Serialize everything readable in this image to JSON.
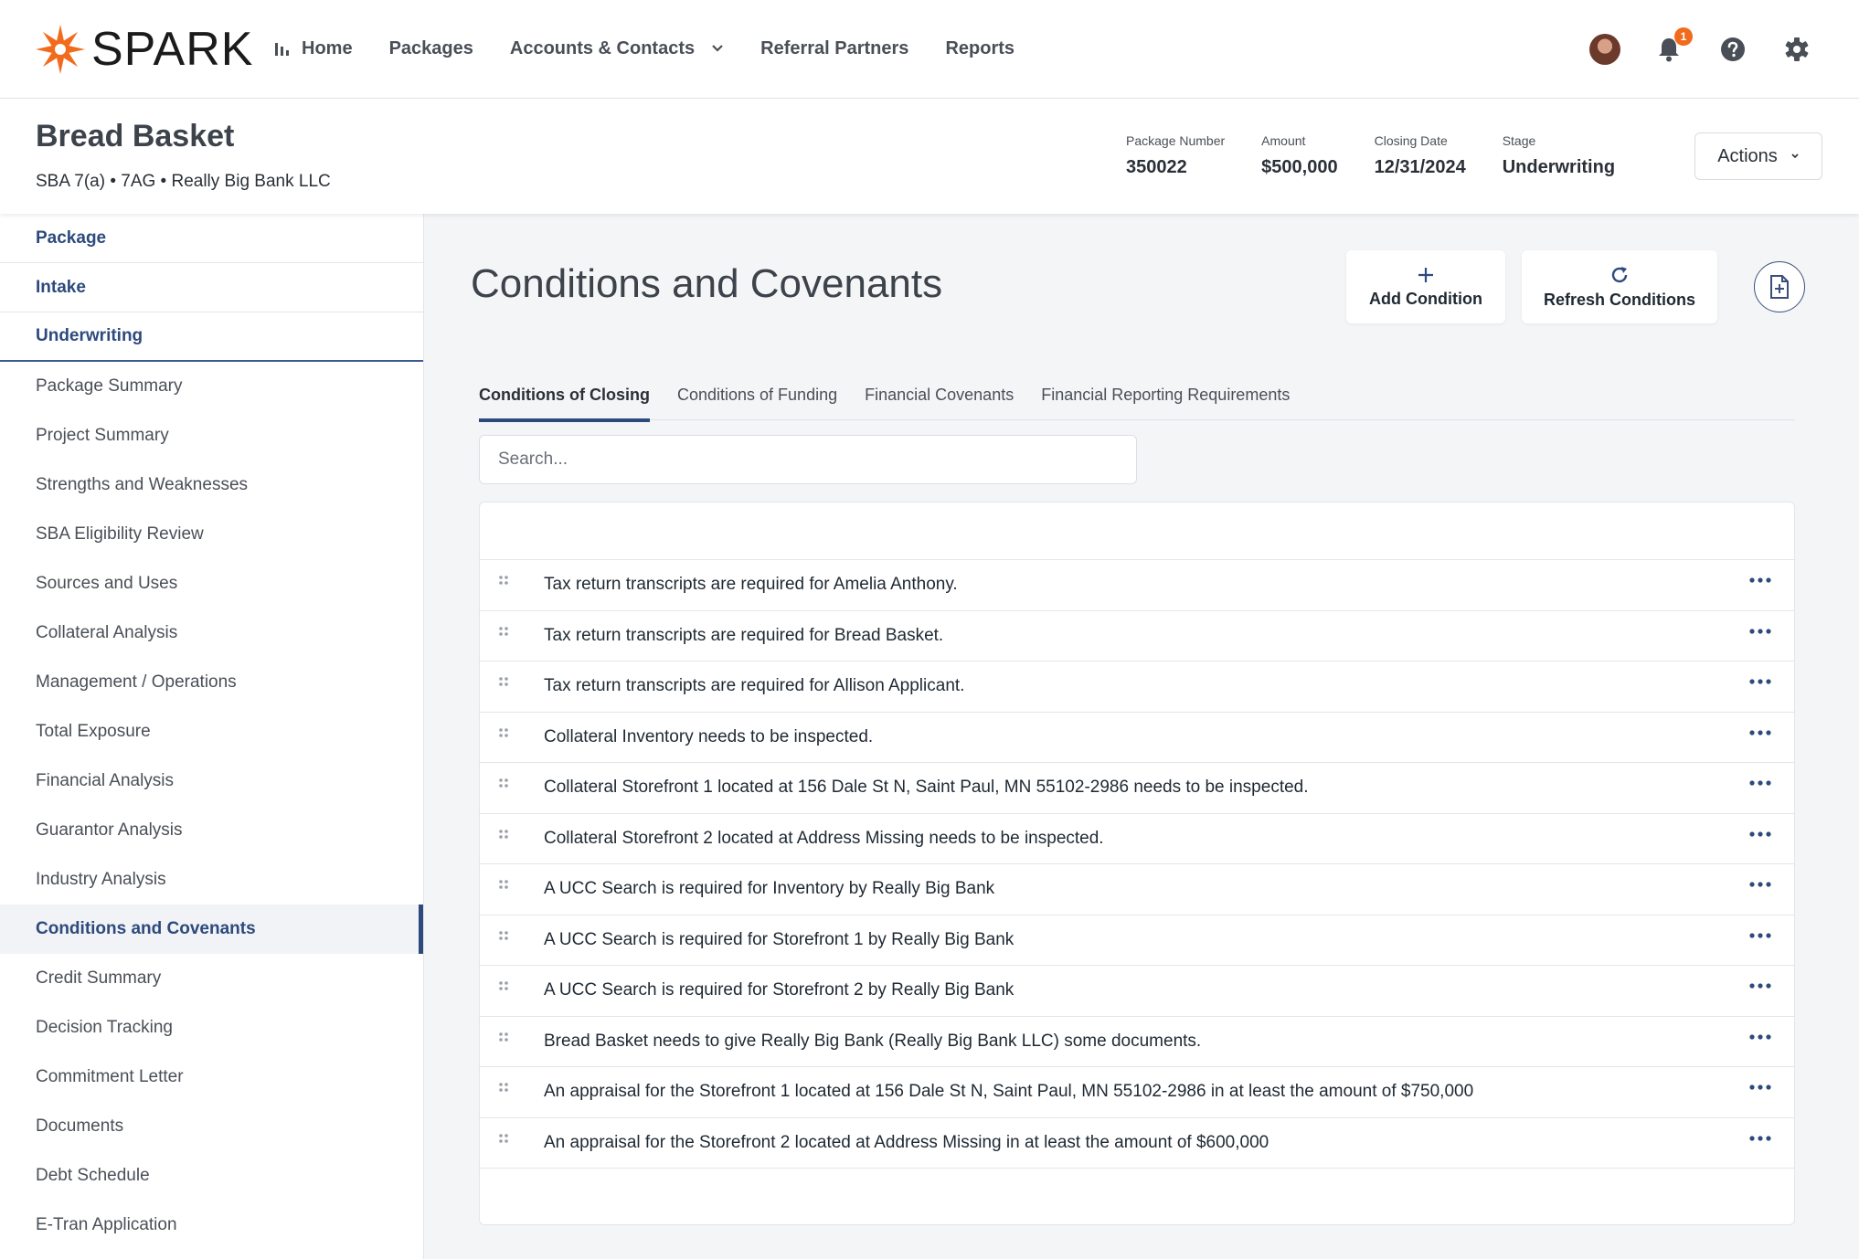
{
  "brand": {
    "name": "SPARK",
    "accent": "#f26b1d",
    "primary": "#2d4a7c"
  },
  "topnav": {
    "links": [
      {
        "label": "Home",
        "icon": "bar-chart-icon"
      },
      {
        "label": "Packages"
      },
      {
        "label": "Accounts & Contacts",
        "icon": "chevron-down-icon"
      },
      {
        "label": "Referral Partners"
      },
      {
        "label": "Reports"
      }
    ],
    "notifications_count": "1"
  },
  "package": {
    "title": "Bread Basket",
    "subtitle": "SBA 7(a) • 7AG • Really Big Bank LLC",
    "fields": [
      {
        "label": "Package Number",
        "value": "350022"
      },
      {
        "label": "Amount",
        "value": "$500,000"
      },
      {
        "label": "Closing Date",
        "value": "12/31/2024"
      },
      {
        "label": "Stage",
        "value": "Underwriting"
      }
    ],
    "actions_label": "Actions"
  },
  "sidebar": {
    "sections": [
      "Package",
      "Intake",
      "Underwriting"
    ],
    "items": [
      "Package Summary",
      "Project Summary",
      "Strengths and Weaknesses",
      "SBA Eligibility Review",
      "Sources and Uses",
      "Collateral Analysis",
      "Management / Operations",
      "Total Exposure",
      "Financial Analysis",
      "Guarantor Analysis",
      "Industry Analysis",
      "Conditions and Covenants",
      "Credit Summary",
      "Decision Tracking",
      "Commitment Letter",
      "Documents",
      "Debt Schedule",
      "E-Tran Application"
    ],
    "active_item": "Conditions and Covenants"
  },
  "main": {
    "title": "Conditions and Covenants",
    "add_label": "Add Condition",
    "refresh_label": "Refresh Conditions",
    "tabs": [
      "Conditions of Closing",
      "Conditions of Funding",
      "Financial Covenants",
      "Financial Reporting Requirements"
    ],
    "active_tab": "Conditions of Closing",
    "search_placeholder": "Search...",
    "conditions": [
      "Tax return transcripts are required for Amelia Anthony.",
      "Tax return transcripts are required for Bread Basket.",
      "Tax return transcripts are required for Allison Applicant.",
      "Collateral Inventory needs to be inspected.",
      "Collateral Storefront 1 located at 156 Dale St N, Saint Paul, MN 55102-2986 needs to be inspected.",
      "Collateral Storefront 2 located at Address Missing needs to be inspected.",
      "A UCC Search is required for Inventory by Really Big Bank",
      "A UCC Search is required for Storefront 1 by Really Big Bank",
      "A UCC Search is required for Storefront 2 by Really Big Bank",
      "Bread Basket needs to give Really Big Bank (Really Big Bank LLC) some documents.",
      "An appraisal for the Storefront 1 located at 156 Dale St N, Saint Paul, MN 55102-2986 in at least the amount of $750,000",
      "An appraisal for the Storefront 2 located at Address Missing in at least the amount of $600,000"
    ]
  }
}
